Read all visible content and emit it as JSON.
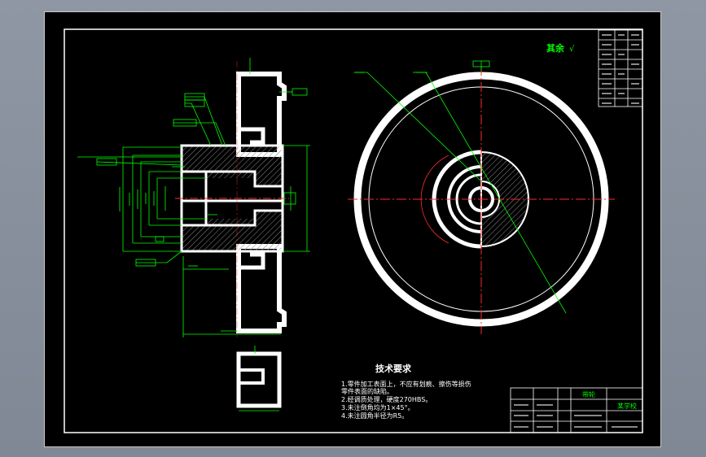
{
  "viewport": {
    "background": "#000000"
  },
  "colors": {
    "outline": "#ffffff",
    "dimension": "#00ff00",
    "centerline": "#ff2a2a",
    "hatch": "#7a7a7a",
    "note_text": "#ffffff",
    "roughness_text": "#00ff00"
  },
  "roughness_note": "其余",
  "roughness_symbol": "√",
  "technical_requirements": {
    "title": "技术要求",
    "items": [
      "1.零件加工表面上，不应有划痕、擦伤等损伤",
      "零件表面的缺陷。",
      "2.经调质处理，硬度270HBS。",
      "3.未注倒角均为1×45°。",
      "4.未注圆角半径为R5。"
    ]
  },
  "title_block": {
    "part_name": "带轮",
    "company": "某学校"
  }
}
